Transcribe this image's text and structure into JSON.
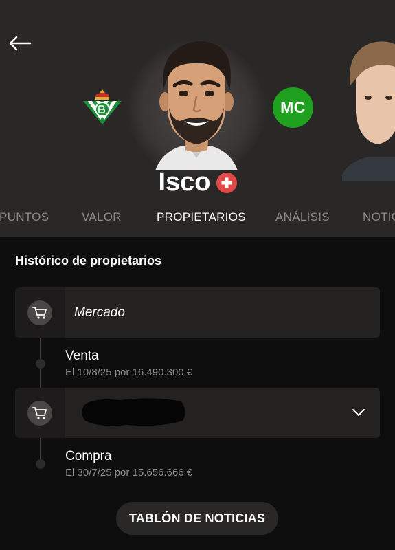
{
  "player": {
    "name": "Isco",
    "position_badge": "MC",
    "position_badge_color": "#1fa01f",
    "status_icon": "injury-cross-icon",
    "status_color": "#e14848"
  },
  "tabs": [
    {
      "label": "PUNTOS",
      "active": false
    },
    {
      "label": "VALOR",
      "active": false
    },
    {
      "label": "PROPIETARIOS",
      "active": true
    },
    {
      "label": "ANÁLISIS",
      "active": false
    },
    {
      "label": "NOTICIAS",
      "active": false
    }
  ],
  "history": {
    "title": "Histórico de propietarios",
    "owners": [
      {
        "name": "Mercado",
        "icon": "cart-icon"
      },
      {
        "name": "",
        "icon": "cart-icon",
        "redacted": true,
        "expandable": true
      }
    ],
    "transactions": [
      {
        "type": "Venta",
        "detail": "El 10/8/25 por 16.490.300 €"
      },
      {
        "type": "Compra",
        "detail": "El 30/7/25 por 15.656.666 €"
      }
    ]
  },
  "news_button": "TABLÓN DE NOTICIAS"
}
